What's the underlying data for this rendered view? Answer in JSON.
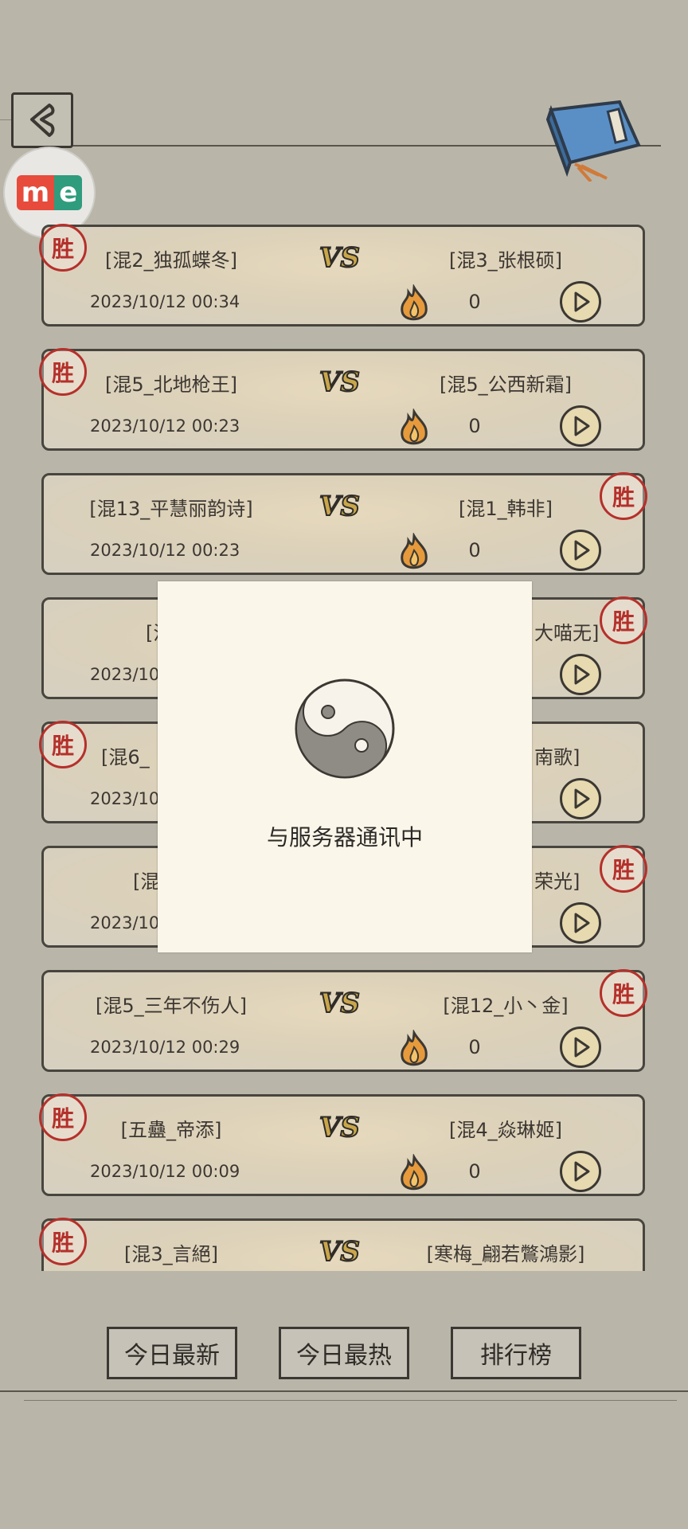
{
  "header": {
    "back_icon": "back-arrow-icon",
    "book_icon": "book-scroll-icon",
    "badge_m": "m",
    "badge_e": "e"
  },
  "matches": [
    {
      "left": "[混2_独孤蝶冬]",
      "right": "[混3_张根硕]",
      "date": "2023/10/12 00:34",
      "heat": "0",
      "winner": "left"
    },
    {
      "left": "[混5_北地枪王]",
      "right": "[混5_公西新霜]",
      "date": "2023/10/12 00:23",
      "heat": "0",
      "winner": "left"
    },
    {
      "left": "[混13_平慧丽韵诗]",
      "right": "[混1_韩非]",
      "date": "2023/10/12 00:23",
      "heat": "0",
      "winner": "right"
    },
    {
      "left": "[混",
      "right": "大喵无]",
      "date": "2023/10",
      "heat": "",
      "winner": "right"
    },
    {
      "left": "[混6_",
      "right": "南歌]",
      "date": "2023/10",
      "heat": "",
      "winner": "left"
    },
    {
      "left": "[混",
      "right": "荣光]",
      "date": "2023/10",
      "heat": "",
      "winner": "right"
    },
    {
      "left": "[混5_三年不伤人]",
      "right": "[混12_小丶金]",
      "date": "2023/10/12 00:29",
      "heat": "0",
      "winner": "right"
    },
    {
      "left": "[五蠱_帝添]",
      "right": "[混4_焱琳姬]",
      "date": "2023/10/12 00:09",
      "heat": "0",
      "winner": "left"
    },
    {
      "left": "[混3_言絕]",
      "right": "[寒梅_翩若鷩鴻影]",
      "date": "",
      "heat": "",
      "winner": "left"
    }
  ],
  "seal_text": "胜",
  "modal": {
    "message": "与服务器通讯中"
  },
  "tabs": [
    {
      "label": "今日最新"
    },
    {
      "label": "今日最热"
    },
    {
      "label": "排行榜"
    }
  ],
  "colors": {
    "background": "#b9b6a9",
    "seal": "#b5302b",
    "card": "#dcd1b9",
    "modal": "#fbf6ea"
  }
}
